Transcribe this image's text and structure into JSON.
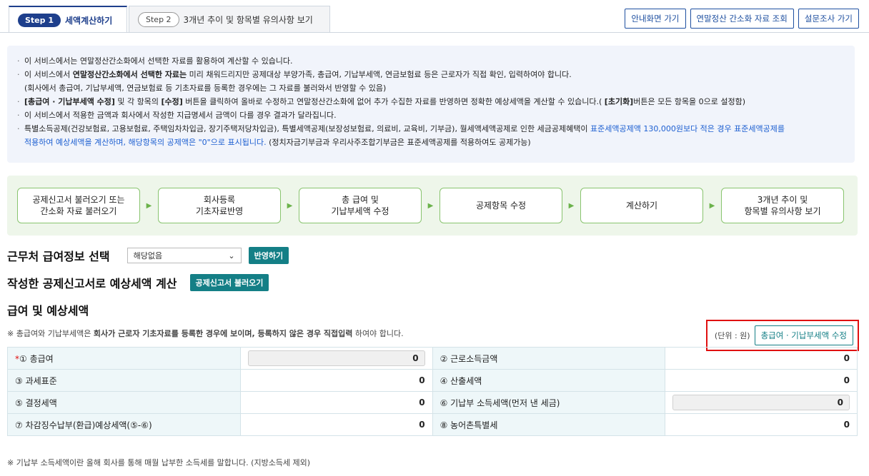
{
  "tabs": {
    "step1_pill": "Step 1",
    "step1_label": "세액계산하기",
    "step2_pill": "Step 2",
    "step2_label": "3개년 추이 및 항목별 유의사항 보기"
  },
  "top_buttons": [
    "안내화면 가기",
    "연말정산 간소화 자료 조회",
    "설문조사 가기"
  ],
  "notice": {
    "l1": "이 서비스에서는 연말정산간소화에서 선택한 자료를 활용하여 계산할 수 있습니다.",
    "l2a": "이 서비스에서 ",
    "l2b": "연말정산간소화에서 선택한 자료는",
    "l2c": " 미리 채워드리지만 공제대상 부양가족, 총급여, 기납부세액, 연금보험료 등은 근로자가 직접 확인, 입력하여야 합니다.",
    "l3": "(회사에서 총급여, 기납부세액, 연금보험료 등 기초자료를 등록한 경우에는 그 자료를 불러와서 반영할 수 있음)",
    "l4a": "[총급여 · 기납부세액 수정]",
    "l4b": " 및 각 항목의 ",
    "l4c": "[수정]",
    "l4d": " 버튼을 클릭하여 올바로 수정하고 연말정산간소화에 없어 추가 수집한 자료를 반영하면 정확한 예상세액을 계산할 수 있습니다.( ",
    "l4e": "[초기화]",
    "l4f": "버튼은 모든 항목을 0으로 설정함)",
    "l5": "이 서비스에서 적용한 금액과 회사에서 작성한 지급명세서 금액이 다를 경우 결과가 달라집니다.",
    "l6a": "특별소득공제(건강보험료, 고용보험료, 주택임차차입금, 장기주택저당차입금), 특별세액공제(보장성보험료, 의료비, 교육비, 기부금), 월세액세액공제로 인한 세금공제혜택이 ",
    "l6b": "표준세액공제액 130,000원보다 적은 경우 표준세액공제를",
    "l7a": "적용하여 예상세액을 계산하며, 해당항목의 공제액은 \"0\"으로 표시됩니다.",
    "l7b": " (정치자금기부금과 우리사주조합기부금은 표준세액공제를 적용하여도 공제가능)"
  },
  "flow": [
    "공제신고서 불러오기 또는\n간소화 자료 불러오기",
    "회사등록\n기초자료반영",
    "총 급여 및\n기납부세액 수정",
    "공제항목 수정",
    "계산하기",
    "3개년 추이 및\n항목별 유의사항 보기"
  ],
  "workplace": {
    "title": "근무처 급여정보 선택",
    "selected": "해당없음",
    "apply_button": "반영하기"
  },
  "declaration": {
    "title": "작성한 공제신고서로 예상세액 계산",
    "load_button": "공제신고서 불러오기"
  },
  "salary": {
    "title": "급여 및 예상세액",
    "note_a": "※ 총급여와 기납부세액은 ",
    "note_b": "회사가 근로자 기초자료를 등록한 경우에 보이며, 등록하지 않은 경우 직접입력",
    "note_c": " 하여야 합니다.",
    "unit": "(단위 : 원)",
    "edit_button": "총급여 · 기납부세액 수정",
    "required_mark": "*",
    "rows": [
      {
        "l1": "① 총급여",
        "v1": "0",
        "l2": "② 근로소득금액",
        "v2": "0"
      },
      {
        "l1": "③ 과세표준",
        "v1": "0",
        "l2": "④ 산출세액",
        "v2": "0"
      },
      {
        "l1": "⑤ 결정세액",
        "v1": "0",
        "l2": "⑥ 기납부 소득세액(먼저 낸 세금)",
        "v2": "0"
      },
      {
        "l1": "⑦ 차감징수납부(환급)예상세액(⑤-⑥)",
        "v1": "0",
        "l2": "⑧ 농어촌특별세",
        "v2": "0"
      }
    ],
    "footnote": "※ 기납부 소득세액이란 올해 회사를 통해 매월 납부한 소득세를 말합니다. (지방소득세 제외)"
  }
}
